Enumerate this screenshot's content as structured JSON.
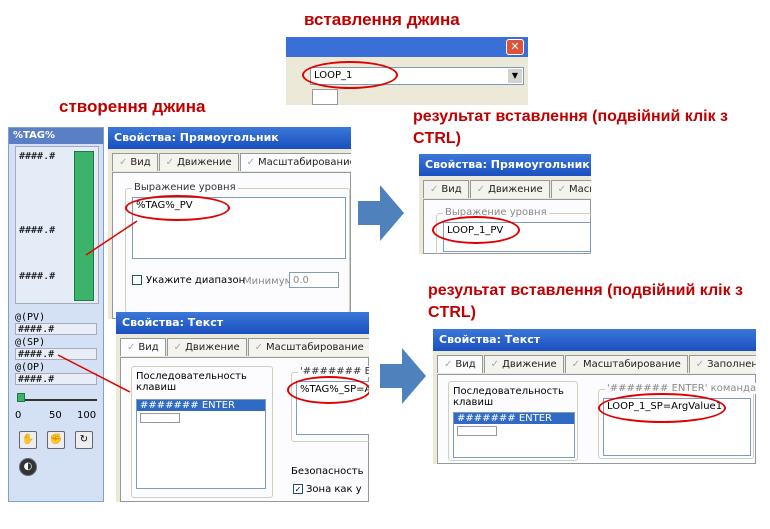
{
  "headings": {
    "insert_genie": "вставлення джина",
    "create_genie": "створення джина",
    "result1": "результат вставлення (подвійний клік з CTRL)",
    "result2": "результат вставлення (подвійний клік з CTRL)"
  },
  "insert_dialog": {
    "combo_value": "LOOP_1"
  },
  "genie": {
    "title": "%TAG%",
    "bar_labels": [
      "####.#",
      "####.#",
      "####.#"
    ],
    "pv_label": "@(PV)",
    "pv_value": "####.#",
    "sp_label": "@(SP)",
    "sp_value": "####.#",
    "op_label": "@(OP)",
    "op_value": "####.#",
    "scale": [
      "0",
      "50",
      "100"
    ]
  },
  "rect_props": {
    "title": "Свойства: Прямоугольник",
    "tabs": [
      "Вид",
      "Движение",
      "Масштабирование"
    ],
    "group_label": "Выражение уровня",
    "expression": "%TAG%_PV",
    "range_label": "Укажите диапазон",
    "min_label": "Минимум:",
    "min_value": "0.0"
  },
  "text_props": {
    "title": "Свойства: Текст",
    "tabs": [
      "Вид",
      "Движение",
      "Масштабирование"
    ],
    "seq_label": "Последовательность клавиш",
    "seq_item": "####### ENTER",
    "cmd_label": "'####### EN",
    "command": "%TAG%_SP=A",
    "security_label": "Безопасность",
    "zone_label": "Зона как у"
  },
  "result_rect": {
    "title": "Свойства: Прямоугольник",
    "tabs": [
      "Вид",
      "Движение",
      "Масшта"
    ],
    "group_label": "Выражение уровня",
    "expression": "LOOP_1_PV"
  },
  "result_text": {
    "title": "Свойства: Текст",
    "tabs": [
      "Вид",
      "Движение",
      "Масштабирование",
      "Заполнение"
    ],
    "seq_label": "Последовательность клавиш",
    "seq_item": "####### ENTER",
    "cmd_label": "'####### ENTER' команда",
    "command": "LOOP_1_SP=ArgValue1"
  }
}
